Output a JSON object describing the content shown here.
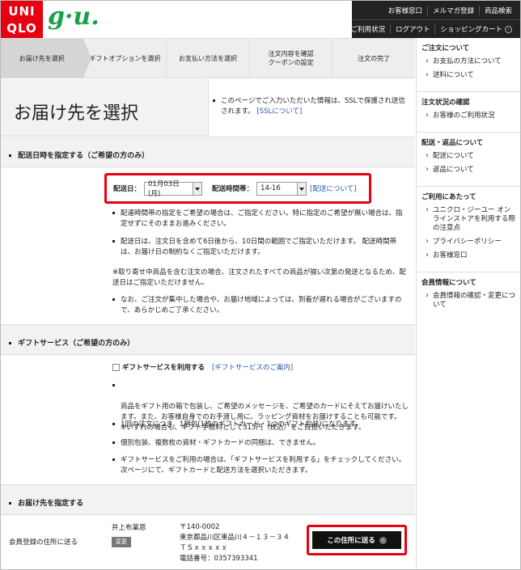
{
  "header": {
    "logo_uniqlo_line1": "UNI",
    "logo_uniqlo_line2": "QLO",
    "logo_gu": "g·u.",
    "top_links": [
      "お客様窓口",
      "メルマガ登録",
      "商品検索"
    ],
    "bottom_links": [
      "ご利用状況",
      "ログアウト",
      "ショッピングカート"
    ]
  },
  "steps": [
    "お届け先を選択",
    "ギフトオプションを選択",
    "お支払い方法を選択",
    "注文内容を確認\nクーポンの設定",
    "注文の完了"
  ],
  "page_title": "お届け先を選択",
  "ssl_note": {
    "text": "このページでご入力いただいた情報は、SSLで保護され送信されます。",
    "link": "[SSLについて]"
  },
  "delivery": {
    "section_title": "配送日時を指定する（ご希望の方のみ）",
    "date_label": "配送日：",
    "date_value": "01月03日(月)",
    "time_label": "配送時間帯：",
    "time_value": "14-16",
    "info_link": "[配送について]",
    "bullets": [
      "配達時間帯の指定をご希望の場合は、ご指定ください。特に指定のご希望が無い場合は、指定せずにそのままお進みください。",
      "配送日は、注文日を含めて6日後から、10日間の範囲でご指定いただけます。 配送時間帯は、お届け日の制約なくご指定いただけます。"
    ],
    "note": "※取り寄せ中商品を含む注文の場合、注文されたすべての商品が揃い次第の発送となるため、配送日はご指定いただけません。",
    "bullet_last": "なお、ご注文が集中した場合や、お届け地域によっては、到着が遅れる場合がございますので、あらかじめご了承ください。"
  },
  "gift": {
    "section_title": "ギフトサービス（ご希望の方のみ）",
    "checkbox_label": "ギフトサービスを利用する",
    "info_link": "[ギフトサービスのご案内]",
    "bullets": [
      "商品をギフト用の箱で包装し、ご希望のメッセージを、ご希望のカードにそえてお届けいたします。また、お客様自身でのお手渡し用に、ラッピング資材をお届けすることも可能です。\n※いずれの場合も、ギフト手数料として315円（税込）をご負担いただきます。",
      "1回の注文につき、1梱包(1枚のギフトカード・1つのギフト包装)になります。",
      "個別包装、複数枚の資材・ギフトカードの同梱は、できません。",
      "ギフトサービスをご利用の場合は、「ギフトサービスを利用する」をチェックしてください。次ページにて、ギフトカードと配送方法を選択いただきます。"
    ]
  },
  "address": {
    "section_title": "お届け先を指定する",
    "row_label": "会員登録の住所に送る",
    "name": "井上布業恩",
    "change_label": "変更",
    "lines": [
      "〒140-0002",
      "東京都品川区東品川４－１３－３４",
      "ＴＳｘｘｘｘｘ",
      "電話番号：0357393341"
    ],
    "send_button": "この住所に送る"
  },
  "sidebar": [
    {
      "title": "ご注文について",
      "items": [
        "お支払の方法について",
        "送料について"
      ]
    },
    {
      "title": "注文状況の確認",
      "items": [
        "お客様のご利用状況"
      ]
    },
    {
      "title": "配送・返品について",
      "items": [
        "配送について",
        "返品について"
      ]
    },
    {
      "title": "ご利用にあたって",
      "items": [
        "ユニクロ・ジーユー オンラインストアを利用する際の注意点",
        "プライバシーポリシー",
        "お客様窓口"
      ]
    },
    {
      "title": "会員情報について",
      "items": [
        "会員情報の確認・変更について"
      ]
    }
  ],
  "colors": {
    "brand_red": "#e60012",
    "gu_green": "#1aa14a",
    "link_blue": "#2a57a8"
  }
}
